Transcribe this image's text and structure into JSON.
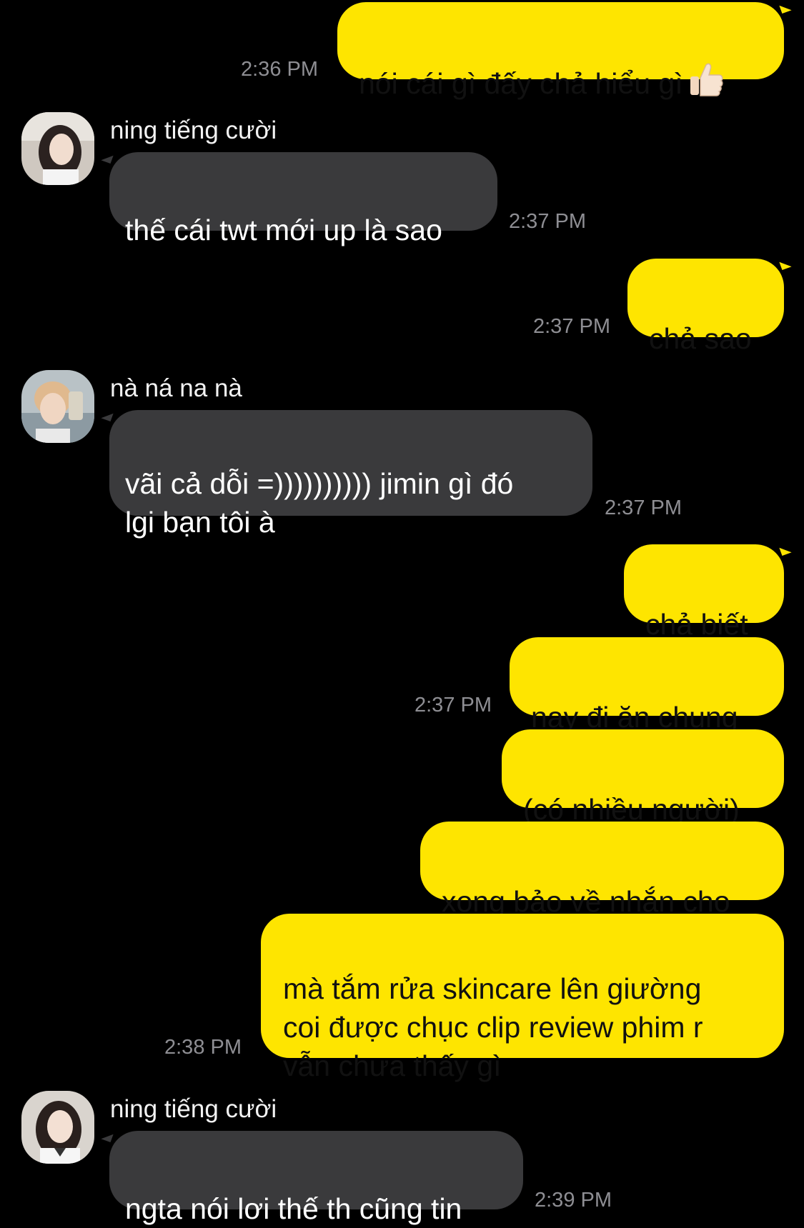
{
  "messages": {
    "m1": {
      "text": "nói cái gì đấy chả hiểu gì",
      "time": "2:36 PM",
      "emoji": "thumbs-up"
    },
    "m2": {
      "sender": "ning tiếng cười",
      "text": "thế cái twt mới up là sao",
      "time": "2:37 PM"
    },
    "m3": {
      "text": "chả sao",
      "time": "2:37 PM"
    },
    "m4": {
      "sender": "nà ná na nà",
      "text": "vãi cả dỗi =)))))))))) jimin gì đó\nlgi bạn tôi à",
      "time": "2:37 PM"
    },
    "m5": {
      "text": "chả biết"
    },
    "m6": {
      "text": "nay đi ăn chung",
      "time": "2:37 PM"
    },
    "m7": {
      "text": "(có nhiều người)"
    },
    "m8": {
      "text": "xong bảo về nhắn cho"
    },
    "m9": {
      "text": "mà tắm rửa skincare lên giường\ncoi được chục clip review phim r\nvẫn chưa thấy gì",
      "time": "2:38 PM"
    },
    "m10": {
      "sender": "ning tiếng cười",
      "text": "ngta nói lơi thế th cũng tin",
      "time": "2:39 PM"
    }
  },
  "colors": {
    "background": "#000000",
    "outgoing_bubble": "#fee500",
    "incoming_bubble": "#3a3a3c",
    "timestamp": "#8e8e93"
  }
}
